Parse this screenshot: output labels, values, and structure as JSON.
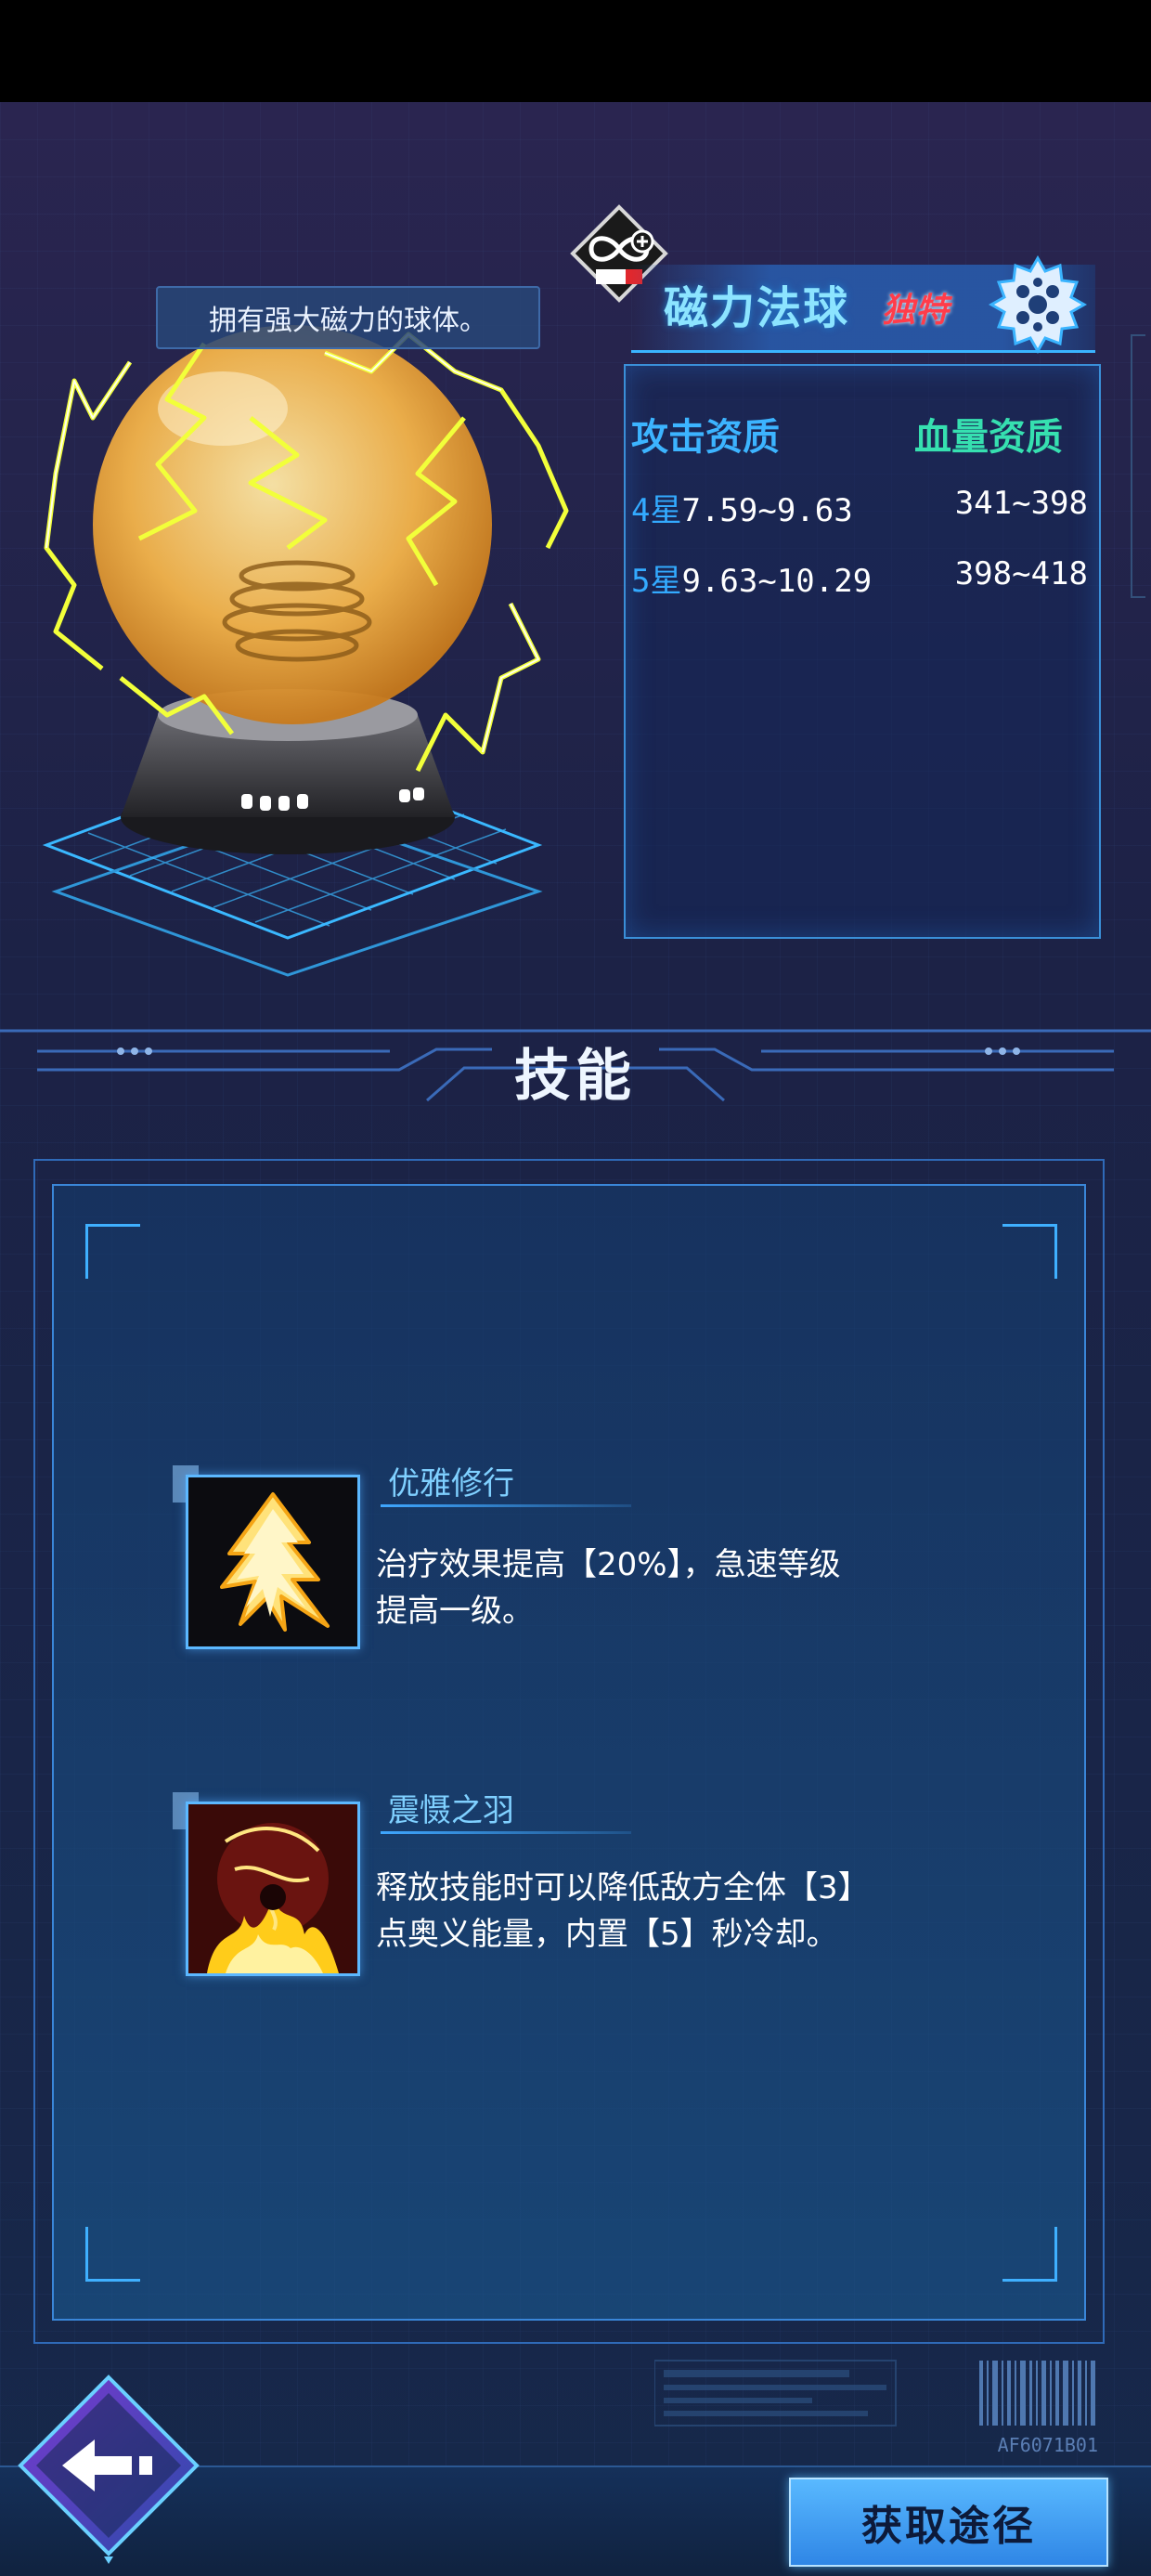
{
  "item": {
    "description": "拥有强大磁力的球体。",
    "name": "磁力法球",
    "tag": "独特"
  },
  "stats": {
    "attack_header": "攻击资质",
    "hp_header": "血量资质",
    "rows": [
      {
        "star": "4星",
        "attack": "7.59~9.63",
        "hp": "341~398"
      },
      {
        "star": "5星",
        "attack": "9.63~10.29",
        "hp": "398~418"
      }
    ]
  },
  "skills": {
    "title": "技能",
    "list": [
      {
        "name": "优雅修行",
        "desc_line1": "治疗效果提高【20%】，急速等级",
        "desc_line2": "提高一级。",
        "icon": "lightning-tree-icon"
      },
      {
        "name": "震慑之羽",
        "desc_line1": "释放技能时可以降低敌方全体【3】",
        "desc_line2": "点奥义能量，内置【5】秒冷却。",
        "icon": "dark-flame-icon"
      }
    ]
  },
  "footer": {
    "code": "AF6071B01",
    "obtain_label": "获取途径"
  },
  "colors": {
    "accent": "#3cb4ff",
    "hp_green": "#36e0b0",
    "unique_red": "#ff3c4a"
  }
}
